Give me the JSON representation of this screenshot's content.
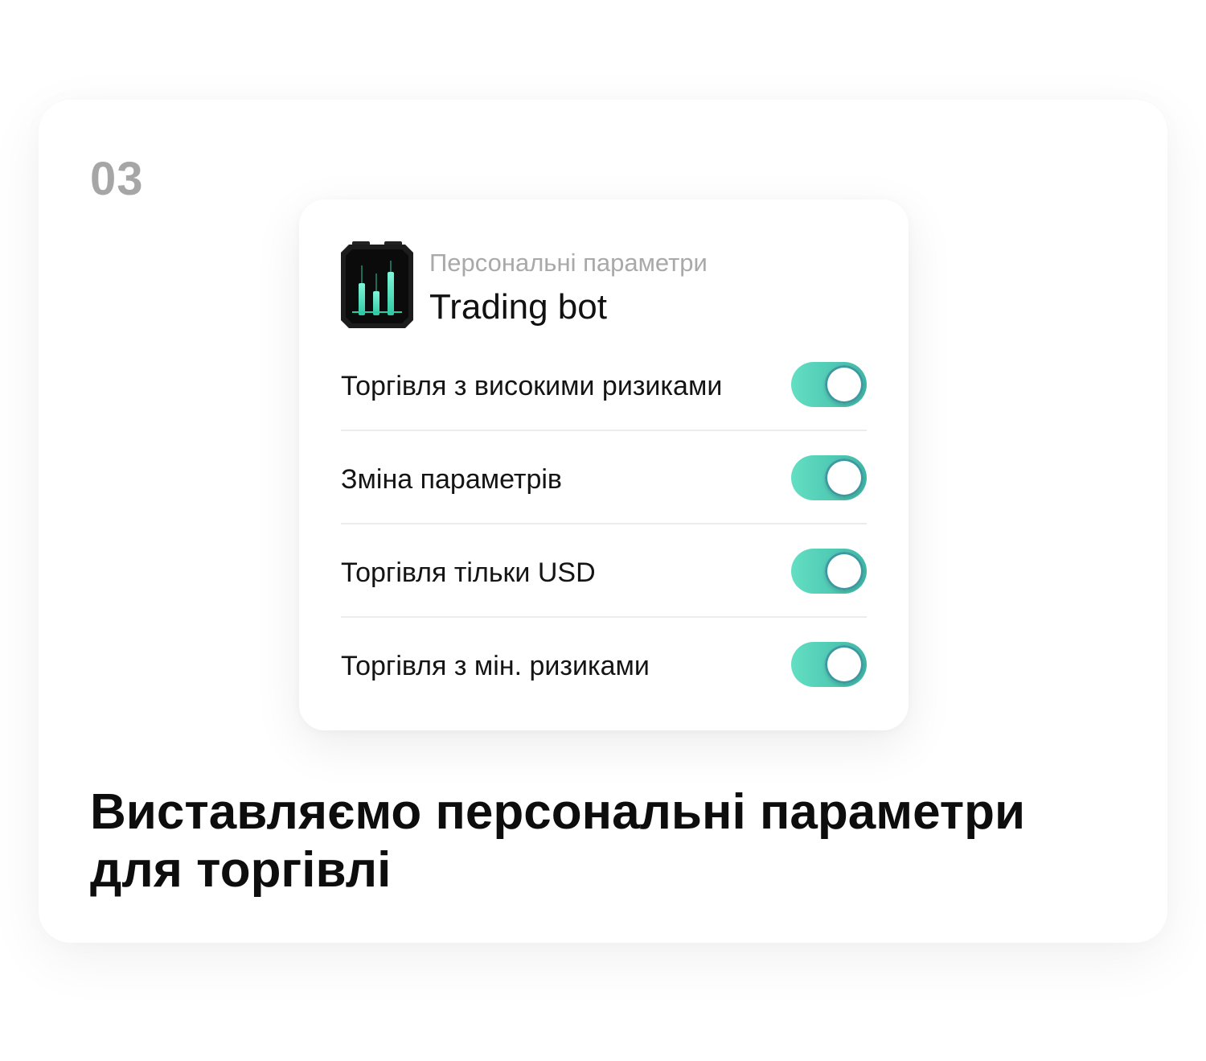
{
  "step": {
    "number": "03"
  },
  "panel": {
    "subtitle": "Персональні параметри",
    "title": "Trading bot",
    "icon": "trading-bot-app-icon"
  },
  "options": [
    {
      "label": "Торгівля з високими ризиками",
      "enabled": true
    },
    {
      "label": "Зміна параметрів",
      "enabled": true
    },
    {
      "label": "Торгівля тільки USD",
      "enabled": true
    },
    {
      "label": "Торгівля з мін. ризиками",
      "enabled": true
    }
  ],
  "headline": "Виставляємо персональні параметри для торгівлі",
  "colors": {
    "toggle_on_start": "#63dfc3",
    "toggle_on_end": "#3fb8a6",
    "step_number": "#a6a6a6",
    "subtitle": "#a9a9a9"
  }
}
